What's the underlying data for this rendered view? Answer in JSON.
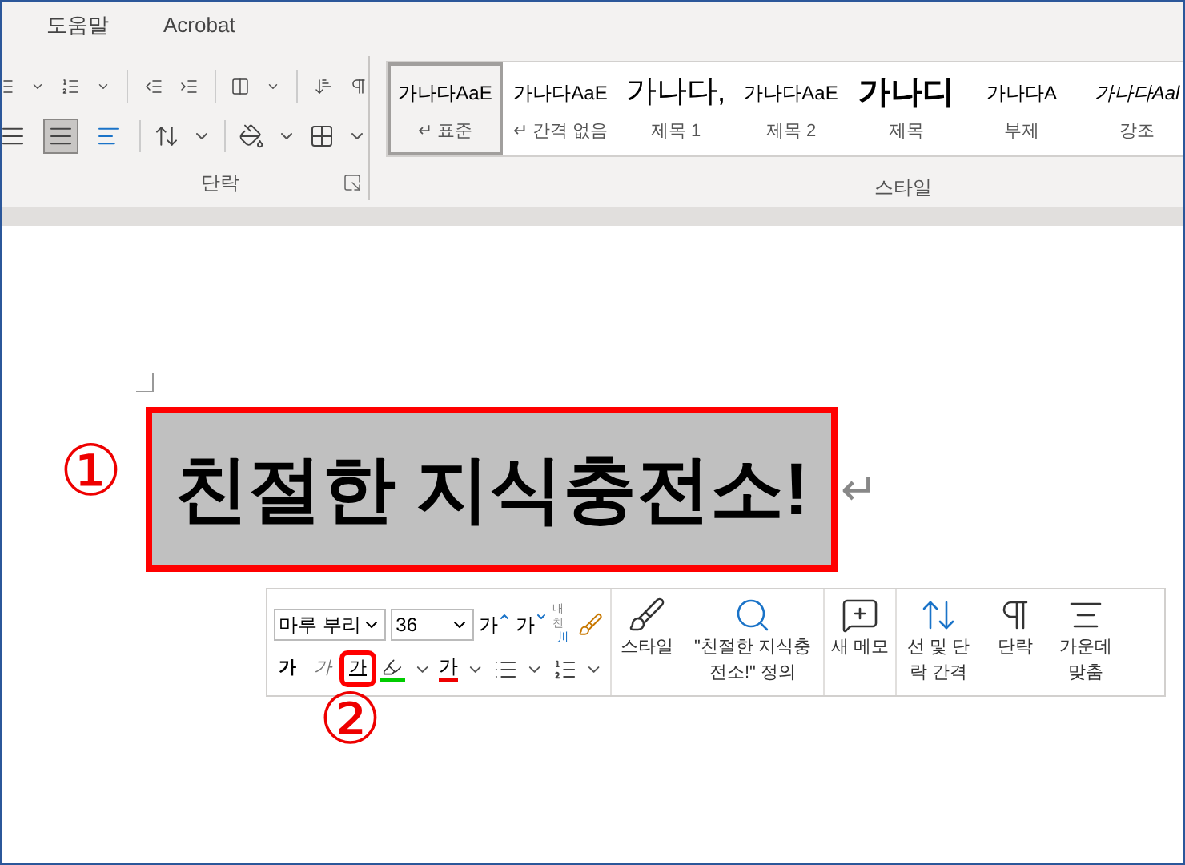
{
  "tabs": [
    {
      "label": "도움말",
      "selected": false
    },
    {
      "label": "Acrobat",
      "selected": false
    }
  ],
  "ribbon": {
    "paragraph": {
      "label": "단락",
      "align_buttons": [
        {
          "selected": false
        },
        {
          "selected": true
        },
        {
          "selected": false
        }
      ]
    },
    "styles": {
      "label": "스타일",
      "items": [
        {
          "preview": "가나다AaE",
          "label": "↵ 표준",
          "kind": "small",
          "selected": true
        },
        {
          "preview": "가나다AaE",
          "label": "↵ 간격 없음",
          "kind": "small",
          "selected": false
        },
        {
          "preview": "가나다,",
          "label": "제목 1",
          "kind": "large",
          "selected": false
        },
        {
          "preview": "가나다AaE",
          "label": "제목 2",
          "kind": "small",
          "selected": false
        },
        {
          "preview": "가나디",
          "label": "제목",
          "kind": "bold",
          "selected": false
        },
        {
          "preview": "가나다A",
          "label": "부제",
          "kind": "small",
          "selected": false
        },
        {
          "preview": "가나다Aal",
          "label": "강조",
          "kind": "italic",
          "selected": false
        }
      ]
    }
  },
  "document": {
    "text": "친절한 지식충전소!",
    "paragraph_mark": "↵",
    "callout": "①"
  },
  "mini_toolbar": {
    "font": "마루 부리",
    "size": "36",
    "grow": "가",
    "shrink": "가",
    "phonetic_top": "내천",
    "phonetic_bottom": "川",
    "format": [
      {
        "label": "가",
        "kind": "bold",
        "selected": false
      },
      {
        "label": "가",
        "kind": "italic",
        "selected": false
      },
      {
        "label": "가",
        "kind": "underline",
        "selected": true
      }
    ],
    "font_color": "가",
    "buttons": [
      {
        "label": "스타일",
        "kind": "style"
      },
      {
        "label": "\"친절한 지식충전소!\" 정의",
        "kind": "define"
      },
      {
        "label": "새 메모",
        "kind": "comment"
      },
      {
        "label": "선 및 단락 간격",
        "kind": "spacing"
      },
      {
        "label": "단락",
        "kind": "paragraph"
      },
      {
        "label": "가운데 맞춤",
        "kind": "center"
      }
    ],
    "callout": "②"
  }
}
